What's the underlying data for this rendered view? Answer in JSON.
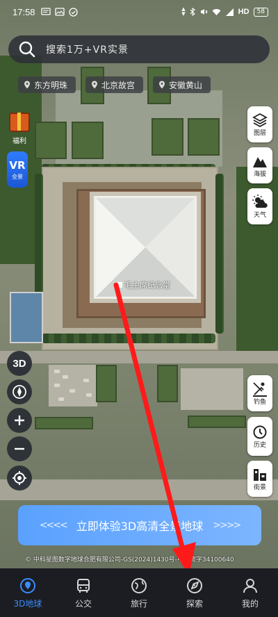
{
  "status_bar": {
    "time": "17:58",
    "network": "HD",
    "battery": "58",
    "icons": [
      "message-icon",
      "image-icon",
      "check-circle-icon",
      "bluetooth-icon",
      "mute-icon",
      "wifi-icon",
      "signal-icon"
    ]
  },
  "search": {
    "placeholder": "搜索1万+VR实景"
  },
  "chips": [
    {
      "label": "东方明珠"
    },
    {
      "label": "北京故宫"
    },
    {
      "label": "安徽黄山"
    }
  ],
  "left_controls": {
    "gift_label": "福利",
    "vr_big": "VR",
    "vr_small": "全景",
    "btn_3d": "3D"
  },
  "right_controls": {
    "layers_label": "图层",
    "elevation_label": "海拔",
    "weather_label": "天气",
    "fishing_label": "钓鱼",
    "history_label": "历史",
    "street_label": "街景"
  },
  "map": {
    "landmark_label": "毛主席纪念堂"
  },
  "cta": {
    "text": "立即体验3D高清全景地球",
    "left_arrows": "<<<<",
    "right_arrows": ">>>>"
  },
  "copyright": "© 中科星图数字地球合肥有限公司-GS(2024)1430号-甲测资字34100640",
  "nav": [
    {
      "label": "3D地球",
      "icon": "globe-pin-icon",
      "active": true
    },
    {
      "label": "公交",
      "icon": "bus-icon",
      "active": false
    },
    {
      "label": "旅行",
      "icon": "compass-globe-icon",
      "active": false
    },
    {
      "label": "探索",
      "icon": "explore-icon",
      "active": false
    },
    {
      "label": "我的",
      "icon": "user-icon",
      "active": false
    }
  ],
  "colors": {
    "accent": "#3b8cff",
    "annotation_arrow": "#ff1a1a",
    "nav_bg": "#1b1d22"
  }
}
